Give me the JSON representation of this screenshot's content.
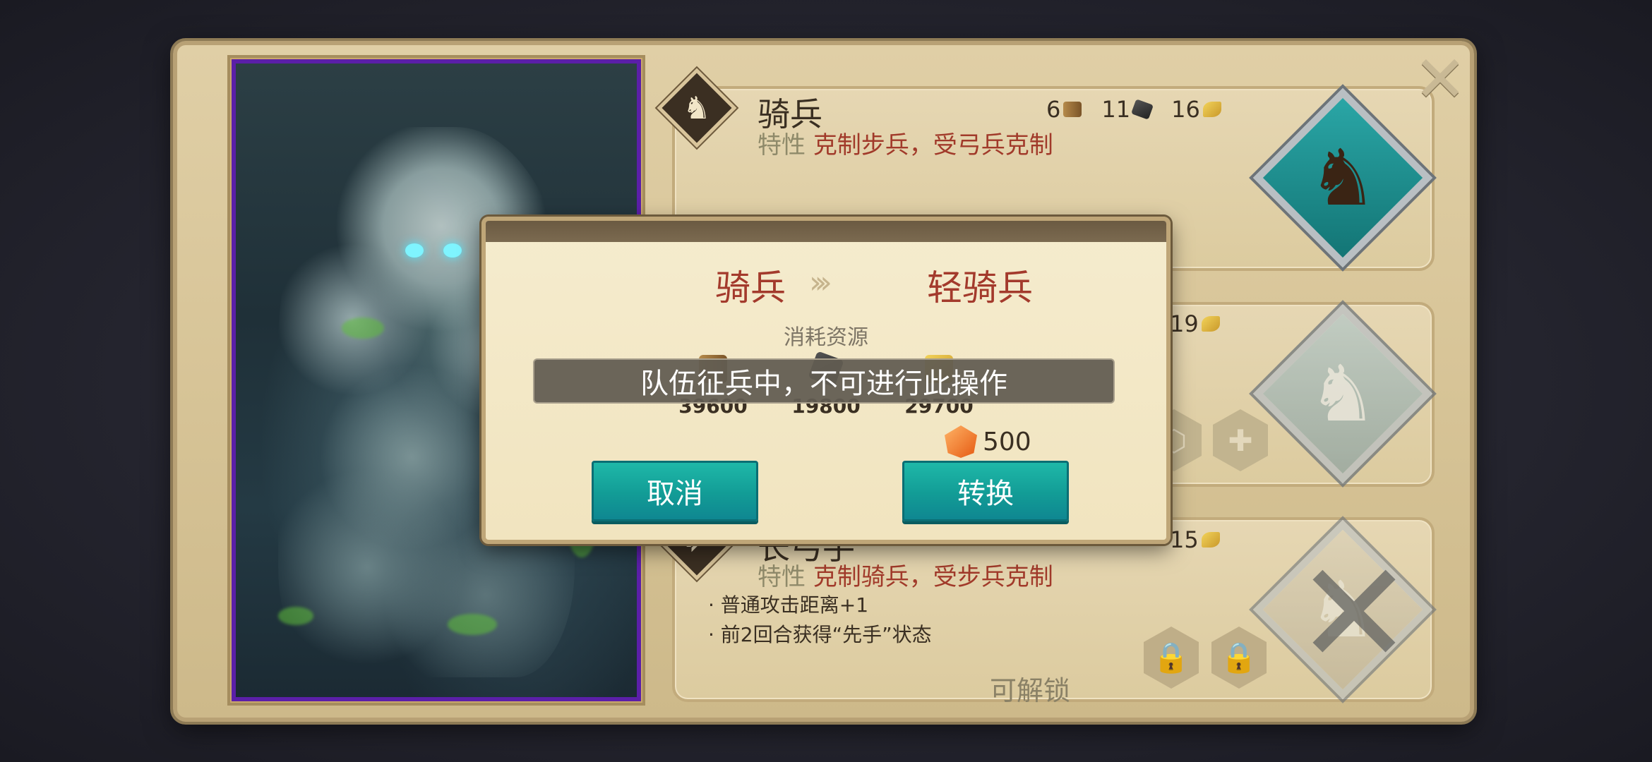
{
  "units": [
    {
      "name": "骑兵",
      "trait_label": "特性",
      "trait_text": "克制步兵，受弓兵克制",
      "resources": [
        {
          "icon": "wood-icon",
          "value": "6"
        },
        {
          "icon": "iron-icon",
          "value": "11"
        },
        {
          "icon": "wheat-icon",
          "value": "16"
        }
      ]
    },
    {
      "resources": [
        {
          "icon": "wheat-icon",
          "value": "19"
        }
      ]
    },
    {
      "name": "长弓手",
      "trait_label": "特性",
      "trait_text": "克制骑兵，受步兵克制",
      "resources": [
        {
          "icon": "wheat-icon",
          "value": "15"
        }
      ],
      "bullets": [
        "· 普通攻击距离+1",
        "· 前2回合获得“先手”状态"
      ],
      "unlock_text": "可解锁"
    }
  ],
  "modal": {
    "from": "骑兵",
    "arrow": "›››",
    "to": "轻骑兵",
    "cost_title": "消耗资源",
    "costs": [
      {
        "icon": "wood-icon",
        "value": "39600"
      },
      {
        "icon": "iron-icon",
        "value": "19800"
      },
      {
        "icon": "wheat-icon",
        "value": "29700"
      }
    ],
    "gem_value": "500",
    "cancel_label": "取消",
    "convert_label": "转换"
  },
  "toast": "队伍征兵中，不可进行此操作",
  "icons": {
    "close": "close-icon",
    "horse": "horse-icon",
    "bow": "bow-icon",
    "lock": "lock-icon",
    "plus": "plus-icon"
  },
  "colors": {
    "accent_teal": "#129c96",
    "trait_red": "#a13a2a",
    "portrait_purple": "#5b1fa8"
  }
}
